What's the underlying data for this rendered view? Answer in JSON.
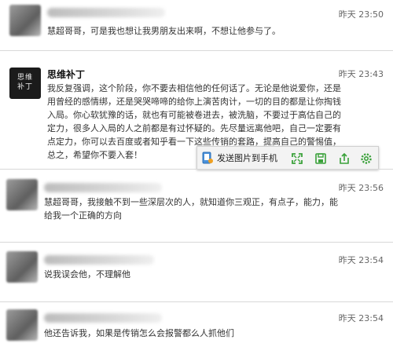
{
  "messages": [
    {
      "time": "昨天 23:50",
      "text": "慧超哥哥，可是我也想让我男朋友出来啊，不想让他参与了。"
    },
    {
      "name": "思维补丁",
      "avatar_text": "思维\n补丁",
      "time": "昨天 23:43",
      "lines": [
        "我反复强调，这个阶段，你不要去相信他的任何话了。无论是他说爱你，还是",
        "用曾经的感情绑，还是哭哭啼啼的给你上演苦肉计，一切的目的都是让你掏钱",
        "入局。你心软犹豫的话，就也有可能被卷进去，被洗脑，不要过于高估自己的",
        "定力，很多人入局的人之前都是有过怀疑的。先尽量远离他吧，自己一定要有",
        "点定力，你可以去百度或者知乎看一下这些传销的套路，提高自己的警惕值，",
        "总之，希望你不要入套！"
      ]
    },
    {
      "time": "昨天 23:56",
      "lines": [
        "慧超哥哥，我接触不到一些深层次的人，就知道你三观正，有点子，能力，能",
        "给我一个正确的方向"
      ]
    },
    {
      "time": "昨天 23:54",
      "text": "说我误会他，不理解他"
    },
    {
      "time": "昨天 23:54",
      "text": "他还告诉我，如果是传销怎么会报警都么人抓他们"
    }
  ],
  "toolbar": {
    "send_label": "发送图片到手机",
    "icons": [
      "fullscreen-icon",
      "save-icon",
      "share-icon",
      "settings-icon"
    ],
    "accent": "#3aa13a"
  }
}
